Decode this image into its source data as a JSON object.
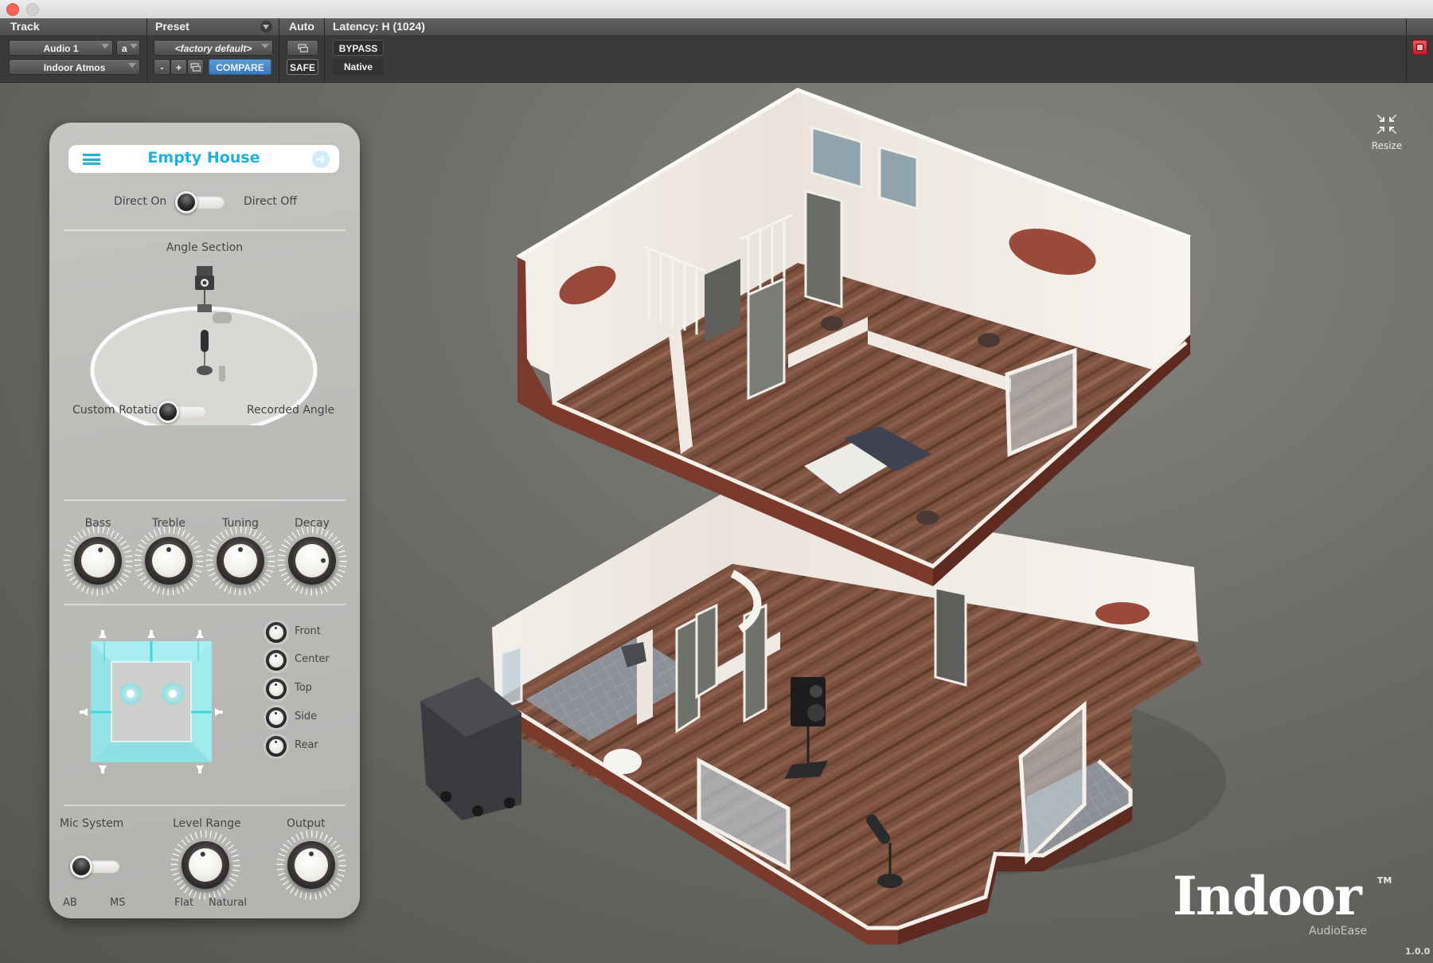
{
  "window": {
    "title_bar_buttons": [
      "close",
      "minimize"
    ]
  },
  "toolbar": {
    "track_header": "Track",
    "preset_header": "Preset",
    "auto_header": "Auto",
    "latency_header": "Latency: H (1024)",
    "track_name": "Audio 1",
    "track_channel": "a",
    "plugin_name": "Indoor Atmos",
    "preset_name": "<factory default>",
    "preset_minus": "-",
    "preset_plus": "+",
    "compare_label": "COMPARE",
    "safe_label": "SAFE",
    "bypass_label": "BYPASS",
    "native_label": "Native"
  },
  "panel": {
    "preset_title": "Empty House",
    "direct_on_label": "Direct On",
    "direct_off_label": "Direct Off",
    "direct_toggle_state": "Direct On",
    "angle_section_label": "Angle Section",
    "custom_rotation_label": "Custom Rotation",
    "recorded_angle_label": "Recorded Angle",
    "rotation_toggle_state": "Custom Rotation",
    "knobs": [
      {
        "label": "Bass",
        "value": 0.55
      },
      {
        "label": "Treble",
        "value": 0.5
      },
      {
        "label": "Tuning",
        "value": 0.5
      },
      {
        "label": "Decay",
        "value": 0.83
      }
    ],
    "channel_knobs": [
      {
        "label": "Front",
        "value": 0.5
      },
      {
        "label": "Center",
        "value": 0.5
      },
      {
        "label": "Top",
        "value": 0.5
      },
      {
        "label": "Side",
        "value": 0.5
      },
      {
        "label": "Rear",
        "value": 0.5
      }
    ],
    "mic_system_label": "Mic System",
    "mic_system_options": [
      "AB",
      "MS"
    ],
    "mic_system_state": "AB",
    "level_range_label": "Level Range",
    "level_range_value": 0.45,
    "level_range_left": "Flat",
    "level_range_right": "Natural",
    "output_label": "Output",
    "output_value": 0.5
  },
  "stage": {
    "resize_label": "Resize",
    "brand_name": "Indoor",
    "brand_tm": "TM",
    "brand_company": "AudioEase",
    "version": "1.0.0"
  },
  "colors": {
    "accent_cyan": "#1fb1d9",
    "compare_blue": "#4a89c8",
    "power_red": "#d8232f",
    "speaker_field": "#8fe3e5"
  }
}
